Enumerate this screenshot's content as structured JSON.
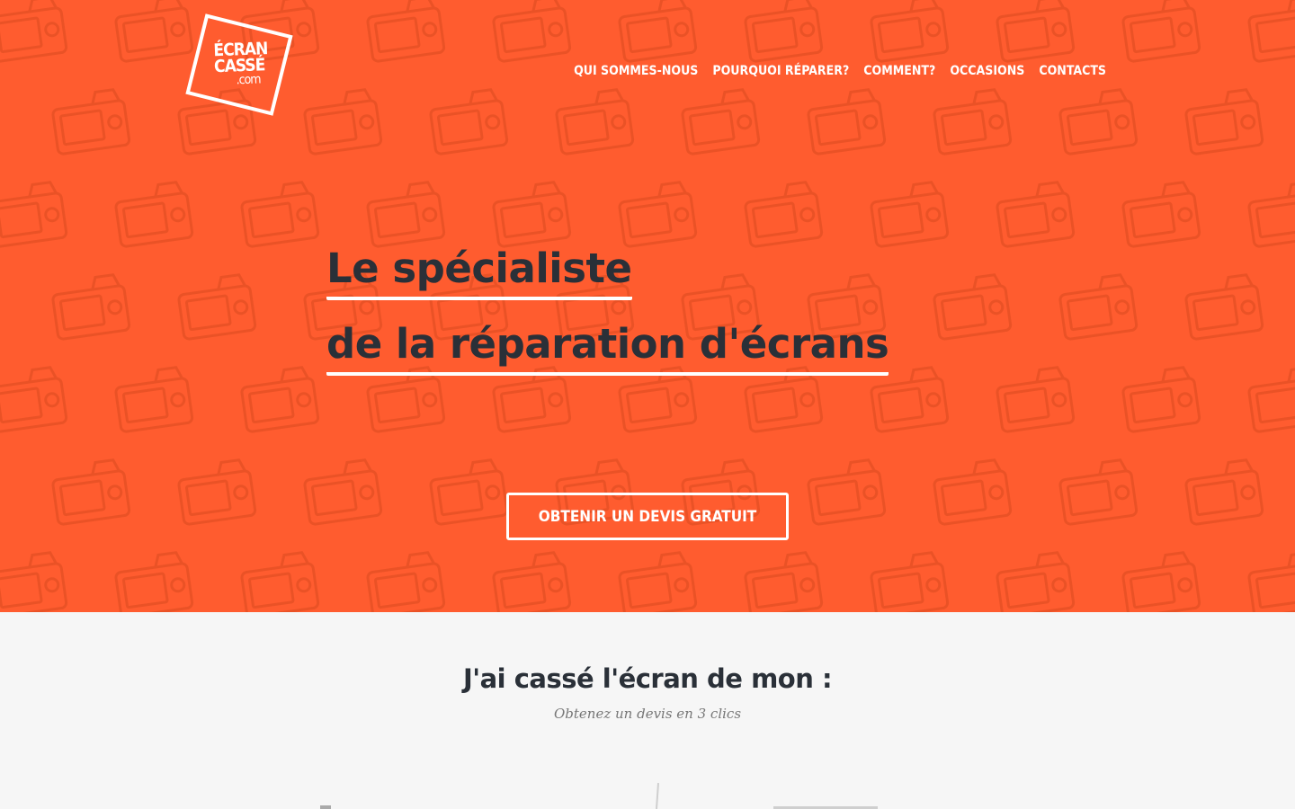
{
  "brand": {
    "logo_line1": "ÉCRAN",
    "logo_line2": "CASSÉ",
    "logo_line3": ".com",
    "accent_color": "#ff5c2f",
    "text_color": "#2a3038"
  },
  "nav": {
    "items": [
      {
        "label": "QUI SOMMES-NOUS"
      },
      {
        "label": "POURQUOI RÉPARER?"
      },
      {
        "label": "COMMENT?"
      },
      {
        "label": "OCCASIONS"
      },
      {
        "label": "CONTACTS"
      }
    ]
  },
  "hero": {
    "headline_line1": "Le spécialiste",
    "headline_line2": "de la réparation d'écrans",
    "cta_label": "OBTENIR UN DEVIS GRATUIT",
    "background_pattern_icon": "camera-icon"
  },
  "section": {
    "title": "J'ai cassé l'écran de mon :",
    "subtitle": "Obtenez un devis en 3 clics"
  }
}
